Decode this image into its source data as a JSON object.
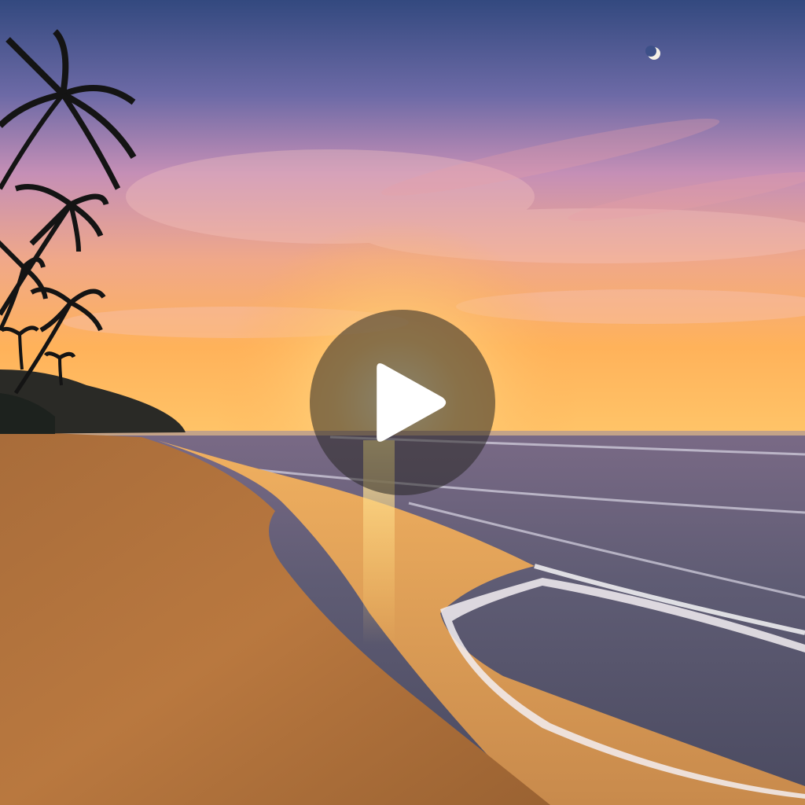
{
  "video": {
    "play_button_icon": "play-icon",
    "colors": {
      "sky_top": "#3b4f8c",
      "sky_mid": "#c98fb4",
      "horizon": "#ffb25a",
      "sun": "#fff1b0",
      "sea": "#5c5a73",
      "sand": "#b8763c",
      "overlay": "#28262480"
    }
  }
}
